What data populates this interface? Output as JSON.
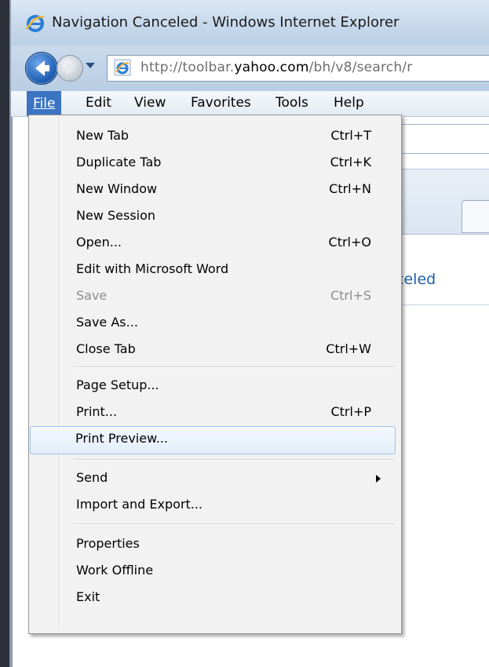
{
  "window": {
    "title": "Navigation Canceled - Windows Internet Explorer"
  },
  "address_bar": {
    "url_prefix": "http://toolbar.",
    "url_domain": "yahoo.com",
    "url_path": "/bh/v8/search/r"
  },
  "menubar": {
    "items": [
      "File",
      "Edit",
      "View",
      "Favorites",
      "Tools",
      "Help"
    ],
    "active": "File"
  },
  "page": {
    "partial_status_text": "nceled"
  },
  "file_menu": {
    "items": [
      {
        "label": "New Tab",
        "shortcut": "Ctrl+T"
      },
      {
        "label": "Duplicate Tab",
        "shortcut": "Ctrl+K"
      },
      {
        "label": "New Window",
        "shortcut": "Ctrl+N"
      },
      {
        "label": "New Session",
        "shortcut": ""
      },
      {
        "label": "Open...",
        "shortcut": "Ctrl+O"
      },
      {
        "label": "Edit with Microsoft Word",
        "shortcut": ""
      },
      {
        "label": "Save",
        "shortcut": "Ctrl+S",
        "disabled": true
      },
      {
        "label": "Save As...",
        "shortcut": ""
      },
      {
        "label": "Close Tab",
        "shortcut": "Ctrl+W"
      },
      {
        "label": "Page Setup...",
        "shortcut": ""
      },
      {
        "label": "Print...",
        "shortcut": "Ctrl+P"
      },
      {
        "label": "Print Preview...",
        "shortcut": "",
        "highlighted": true
      },
      {
        "label": "Send",
        "shortcut": "",
        "submenu": true
      },
      {
        "label": "Import and Export...",
        "shortcut": ""
      },
      {
        "label": "Properties",
        "shortcut": ""
      },
      {
        "label": "Work Offline",
        "shortcut": ""
      },
      {
        "label": "Exit",
        "shortcut": ""
      }
    ]
  },
  "colors": {
    "menu_active_bg": "#3b74c2",
    "link_blue": "#1f5fa8",
    "highlight_border": "#9ec2e8"
  },
  "icons": {
    "title": "ie-logo-icon",
    "back": "back-arrow-icon",
    "forward": "forward-arrow-icon",
    "page": "ie-page-icon",
    "submenu": "submenu-arrow-icon"
  }
}
